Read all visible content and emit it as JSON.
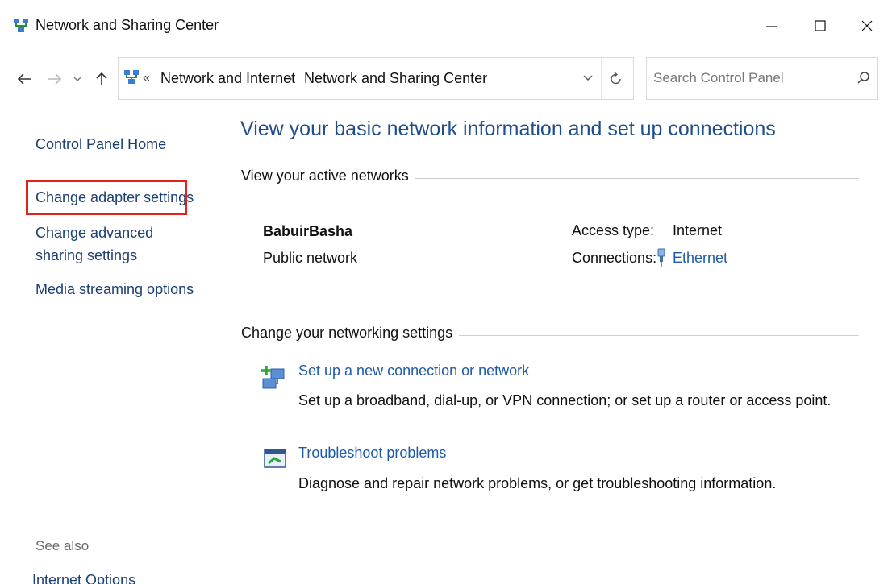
{
  "window": {
    "title": "Network and Sharing Center",
    "controls": {
      "minimize": "—",
      "maximize": "☐",
      "close": "X"
    }
  },
  "address": {
    "chevron": "«",
    "crumbs": [
      "Network and Internet",
      "Network and Sharing Center"
    ],
    "separator": "›"
  },
  "search": {
    "placeholder": "Search Control Panel",
    "value": ""
  },
  "sidebar": {
    "links": [
      "Control Panel Home",
      "Change adapter settings",
      "Change advanced sharing settings",
      "Media streaming options"
    ],
    "see_also_label": "See also",
    "see_also_links": [
      "Internet Options"
    ]
  },
  "main": {
    "heading": "View your basic network information and set up connections",
    "active_networks_label": "View your active networks",
    "network": {
      "name": "BabuirBasha",
      "type": "Public network",
      "access_type_label": "Access type:",
      "access_type_value": "Internet",
      "connections_label": "Connections:",
      "connection_name": "Ethernet"
    },
    "change_settings_label": "Change your networking settings",
    "tasks": [
      {
        "title": "Set up a new connection or network",
        "description": "Set up a broadband, dial-up, or VPN connection; or set up a router or access point."
      },
      {
        "title": "Troubleshoot problems",
        "description": "Diagnose and repair network problems, or get troubleshooting information."
      }
    ]
  },
  "colors": {
    "link": "#1e5aa8",
    "heading": "#1e4e8c",
    "highlight": "#e2231a"
  },
  "icons": [
    "network-center-icon",
    "back-arrow-icon",
    "forward-arrow-icon",
    "recent-locations-icon",
    "up-arrow-icon",
    "dropdown-chevron-icon",
    "refresh-icon",
    "search-icon",
    "ethernet-plug-icon",
    "new-connection-icon",
    "troubleshoot-icon"
  ]
}
